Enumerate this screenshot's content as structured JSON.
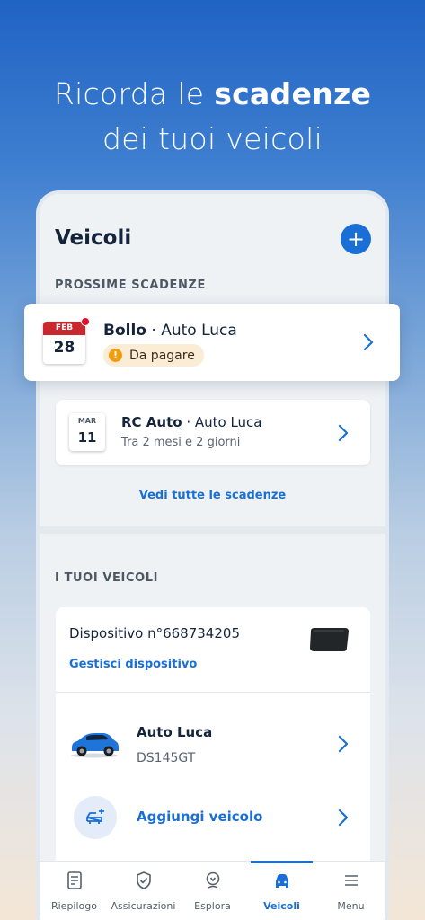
{
  "headline": {
    "line1_regular": "Ricorda le ",
    "line1_bold": "scadenze",
    "line2": "dei tuoi veicoli"
  },
  "screen": {
    "title": "Veicoli",
    "add_button_label": "+",
    "upcoming_section": "PROSSIME SCADENZE",
    "deadlines": [
      {
        "month": "FEB",
        "day": "28",
        "title_bold": "Bollo",
        "title_rest": " · Auto Luca",
        "badge": "Da pagare",
        "badge_icon": "!",
        "month_color": "#c8282e",
        "has_alert_dot": true
      },
      {
        "month": "MAR",
        "day": "11",
        "title_bold": "RC Auto",
        "title_rest": " · Auto Luca",
        "subtitle": "Tra 2 mesi e 2 giorni"
      }
    ],
    "see_all_link": "Vedi tutte le scadenze",
    "vehicles_section": "I TUOI VEICOLI",
    "device": {
      "label": "Dispositivo n°668734205",
      "manage_link": "Gestisci dispositivo"
    },
    "vehicle": {
      "name": "Auto Luca",
      "plate": "DS145GT"
    },
    "add_vehicle_label": "Aggiungi veicolo"
  },
  "tabbar": [
    {
      "label": "Riepilogo",
      "icon": "document-icon",
      "active": false
    },
    {
      "label": "Assicurazioni",
      "icon": "shield-check-icon",
      "active": false
    },
    {
      "label": "Esplora",
      "icon": "location-pin-icon",
      "active": false
    },
    {
      "label": "Veicoli",
      "icon": "car-icon",
      "active": true
    },
    {
      "label": "Menu",
      "icon": "hamburger-menu-icon",
      "active": false
    }
  ],
  "colors": {
    "accent": "#1a6fd6",
    "alert": "#c8282e",
    "warning": "#f29e0c",
    "badge_bg": "#fbecd6"
  }
}
